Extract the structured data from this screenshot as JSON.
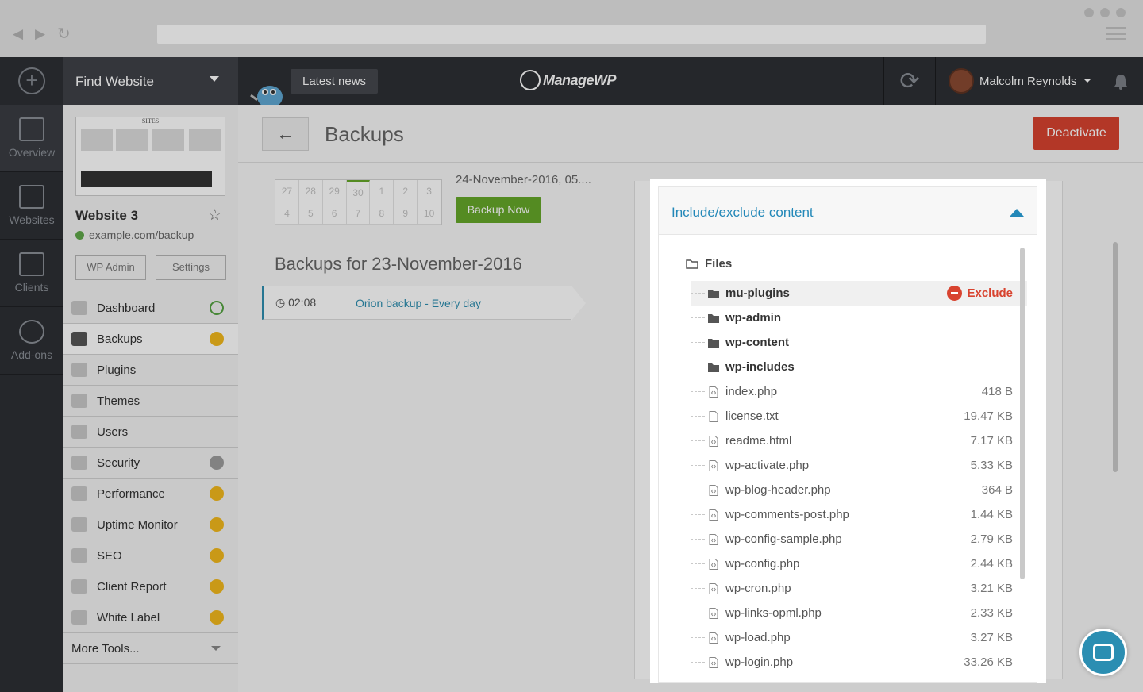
{
  "topbar": {
    "find_website": "Find Website",
    "latest_news": "Latest news",
    "logo_text": "ManageWP",
    "user_name": "Malcolm Reynolds"
  },
  "leftnav": [
    {
      "label": "Overview",
      "icon": "overview-icon"
    },
    {
      "label": "Websites",
      "icon": "websites-icon"
    },
    {
      "label": "Clients",
      "icon": "clients-icon"
    },
    {
      "label": "Add-ons",
      "icon": "addons-icon"
    }
  ],
  "site": {
    "name": "Website 3",
    "url": "example.com/backup",
    "wp_admin": "WP Admin",
    "settings": "Settings",
    "thumb_header": "SITES"
  },
  "menu": [
    {
      "label": "Dashboard",
      "badge": "sync"
    },
    {
      "label": "Backups",
      "badge": "gold"
    },
    {
      "label": "Plugins",
      "badge": ""
    },
    {
      "label": "Themes",
      "badge": ""
    },
    {
      "label": "Users",
      "badge": ""
    },
    {
      "label": "Security",
      "badge": "grey"
    },
    {
      "label": "Performance",
      "badge": "gold"
    },
    {
      "label": "Uptime Monitor",
      "badge": "gold"
    },
    {
      "label": "SEO",
      "badge": "gold"
    },
    {
      "label": "Client Report",
      "badge": "gold"
    },
    {
      "label": "White Label",
      "badge": "gold"
    },
    {
      "label": "More Tools...",
      "badge": "caret"
    }
  ],
  "main": {
    "back": "←",
    "title": "Backups",
    "deactivate": "Deactivate",
    "calendar_row1": [
      "27",
      "28",
      "29",
      "30",
      "1",
      "2",
      "3"
    ],
    "calendar_row2": [
      "4",
      "5",
      "6",
      "7",
      "8",
      "9",
      "10"
    ],
    "last_backup": "24-November-2016, 05....",
    "backup_now": "Backup Now",
    "backups_for": "Backups for 23-November-2016",
    "backup_time": "02:08",
    "backup_name": "Orion backup - Every day"
  },
  "modal": {
    "title": "Include/exclude content",
    "root": "Files",
    "exclude_label": "Exclude",
    "rows": [
      {
        "name": "mu-plugins",
        "size": "",
        "type": "folder"
      },
      {
        "name": "wp-admin",
        "size": "",
        "type": "folder"
      },
      {
        "name": "wp-content",
        "size": "",
        "type": "folder"
      },
      {
        "name": "wp-includes",
        "size": "",
        "type": "folder"
      },
      {
        "name": "index.php",
        "size": "418 B",
        "type": "code"
      },
      {
        "name": "license.txt",
        "size": "19.47 KB",
        "type": "text"
      },
      {
        "name": "readme.html",
        "size": "7.17 KB",
        "type": "code"
      },
      {
        "name": "wp-activate.php",
        "size": "5.33 KB",
        "type": "code"
      },
      {
        "name": "wp-blog-header.php",
        "size": "364 B",
        "type": "code"
      },
      {
        "name": "wp-comments-post.php",
        "size": "1.44 KB",
        "type": "code"
      },
      {
        "name": "wp-config-sample.php",
        "size": "2.79 KB",
        "type": "code"
      },
      {
        "name": "wp-config.php",
        "size": "2.44 KB",
        "type": "code"
      },
      {
        "name": "wp-cron.php",
        "size": "3.21 KB",
        "type": "code"
      },
      {
        "name": "wp-links-opml.php",
        "size": "2.33 KB",
        "type": "code"
      },
      {
        "name": "wp-load.php",
        "size": "3.27 KB",
        "type": "code"
      },
      {
        "name": "wp-login.php",
        "size": "33.26 KB",
        "type": "code"
      }
    ]
  },
  "colors": {
    "accent": "#2388b8",
    "danger": "#d8432f",
    "success": "#66a82a",
    "badge": "#f2b81c"
  }
}
